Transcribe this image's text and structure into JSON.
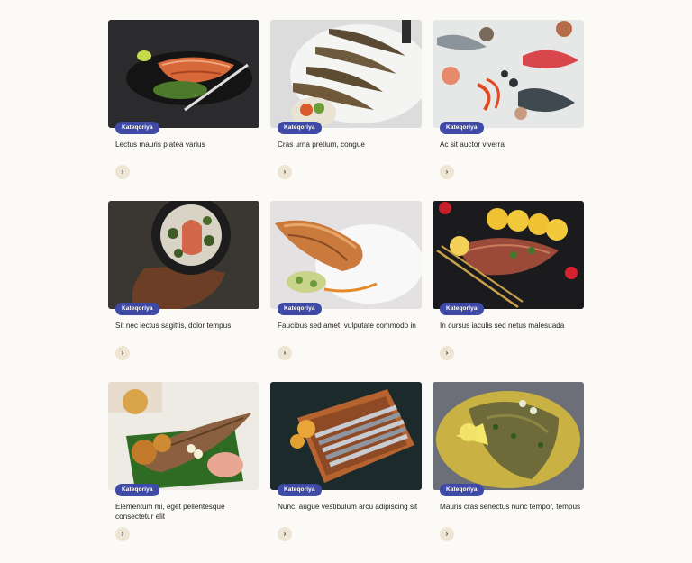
{
  "cards": [
    {
      "category": "Kateqoriya",
      "title": "Lectus mauris platea varius",
      "arrow": "›",
      "image": "grilled-salmon-plate"
    },
    {
      "category": "Kateqoriya",
      "title": "Cras urna pretium, congue",
      "arrow": "›",
      "image": "grilled-sardines-platter"
    },
    {
      "category": "Kateqoriya",
      "title": "Ac sit auctor viverra",
      "arrow": "›",
      "image": "raw-seafood-on-ice"
    },
    {
      "category": "Kateqoriya",
      "title": "Sit nec lectus sagittis, dolor tempus",
      "arrow": "›",
      "image": "salmon-bowl-on-board"
    },
    {
      "category": "Kateqoriya",
      "title": "Faucibus sed amet, vulputate commodo in",
      "arrow": "›",
      "image": "salmon-fillet-plate"
    },
    {
      "category": "Kateqoriya",
      "title": "In cursus iaculis sed netus malesuada",
      "arrow": "›",
      "image": "fish-with-lemon-slices"
    },
    {
      "category": "Kateqoriya",
      "title": "Elementum mi, eget pellentesque consectetur elit",
      "arrow": "›",
      "image": "fried-fish-banana-leaf"
    },
    {
      "category": "Kateqoriya",
      "title": "Nunc, augue vestibulum arcu adipiscing sit",
      "arrow": "›",
      "image": "sardines-in-dish"
    },
    {
      "category": "Kateqoriya",
      "title": "Mauris cras senectus nunc tempor, tempus",
      "arrow": "›",
      "image": "fish-in-herb-sauce"
    }
  ]
}
